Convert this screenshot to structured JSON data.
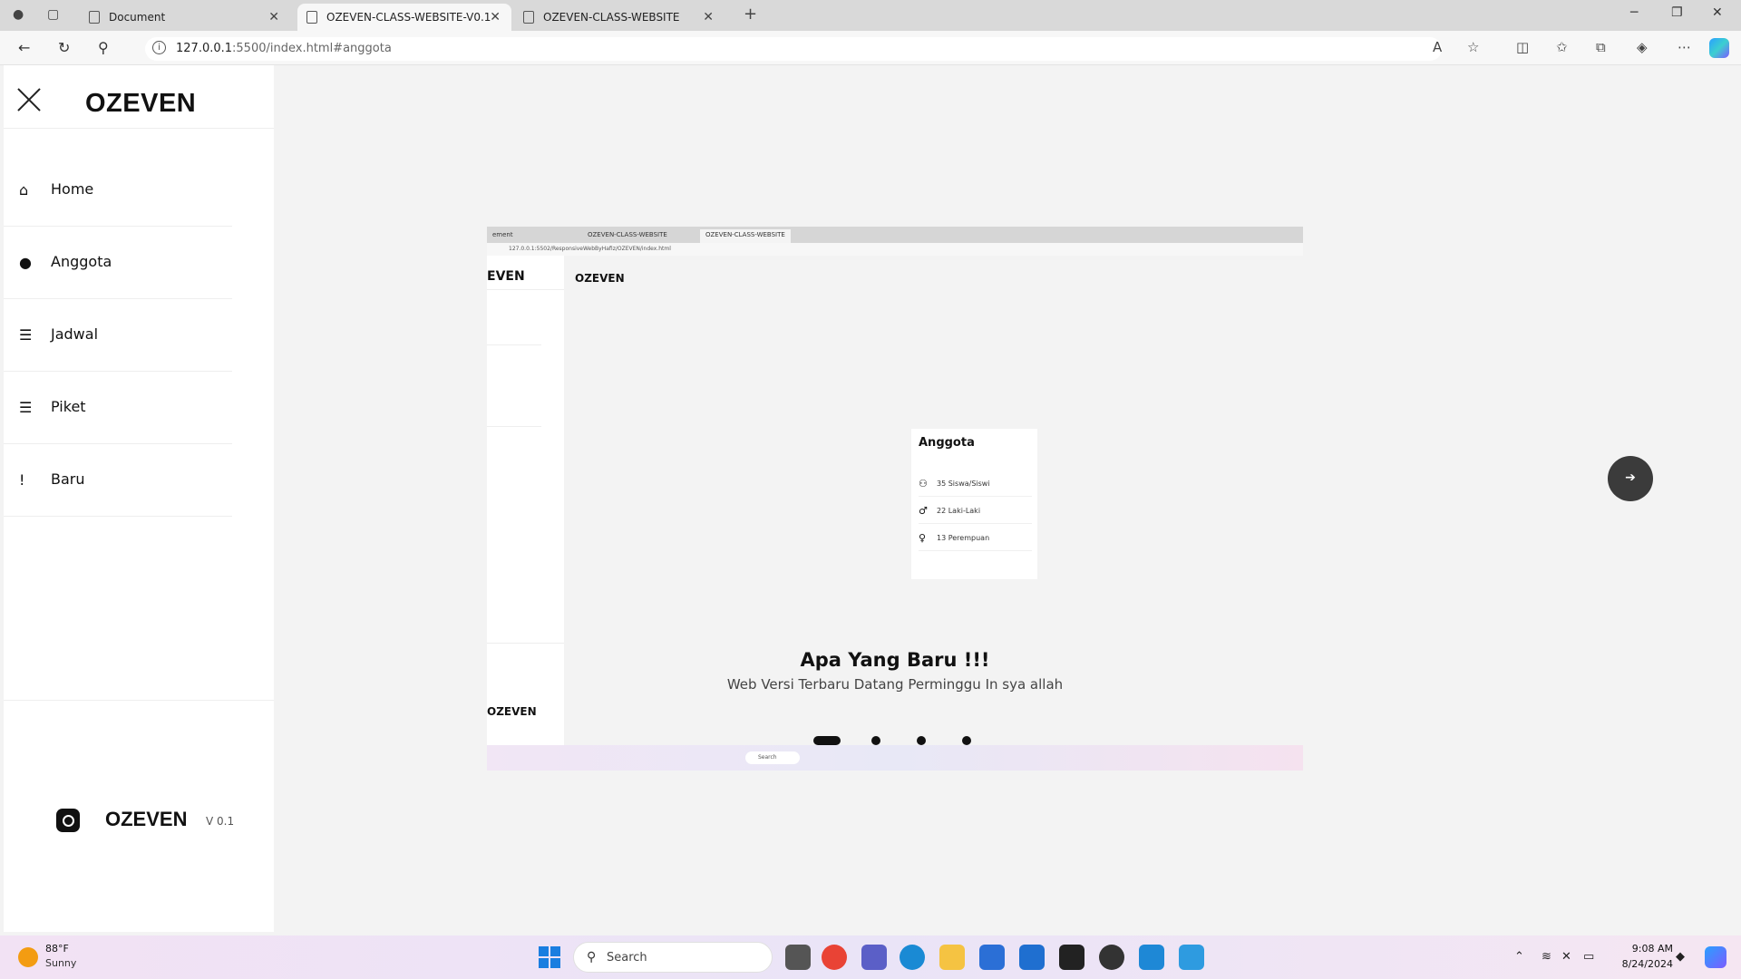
{
  "browser": {
    "tabs": [
      {
        "label": "Document",
        "active": false
      },
      {
        "label": "OZEVEN-CLASS-WEBSITE-V0.1",
        "active": true
      },
      {
        "label": "OZEVEN-CLASS-WEBSITE",
        "active": false
      }
    ],
    "url_host": "127.0.0.1",
    "url_rest": ":5500/index.html#anggota"
  },
  "sidebar": {
    "brand": "OZEVEN",
    "items": [
      {
        "label": "Home",
        "icon": "home-icon"
      },
      {
        "label": "Anggota",
        "icon": "user-icon"
      },
      {
        "label": "Jadwal",
        "icon": "list-icon"
      },
      {
        "label": "Piket",
        "icon": "list-icon"
      },
      {
        "label": "Baru",
        "icon": "new-icon"
      }
    ],
    "footer_brand": "OZEVEN",
    "version": "V 0.1"
  },
  "slide": {
    "tabs": [
      "ement",
      "OZEVEN-CLASS-WEBSITE",
      "OZEVEN-CLASS-WEBSITE"
    ],
    "url": "127.0.0.1:5502/ResponsiveWebByHafiz/OZEVEN/index.html",
    "side_brand": "EVEN",
    "side_brand_bottom": "OZEVEN",
    "header_brand": "OZEVEN",
    "card_title": "Anggota",
    "card_rows": [
      "35 Siswa/Siswi",
      "22 Laki-Laki",
      "13 Perempuan"
    ],
    "taskbar_search": "Search"
  },
  "carousel": {
    "title": "Apa Yang Baru !!!",
    "subtitle": "Web Versi Terbaru Datang Perminggu In sya allah",
    "dots": 4,
    "active_dot": 0
  },
  "taskbar": {
    "temp": "88°F",
    "condition": "Sunny",
    "search": "Search",
    "time": "9:08 AM",
    "date": "8/24/2024"
  }
}
